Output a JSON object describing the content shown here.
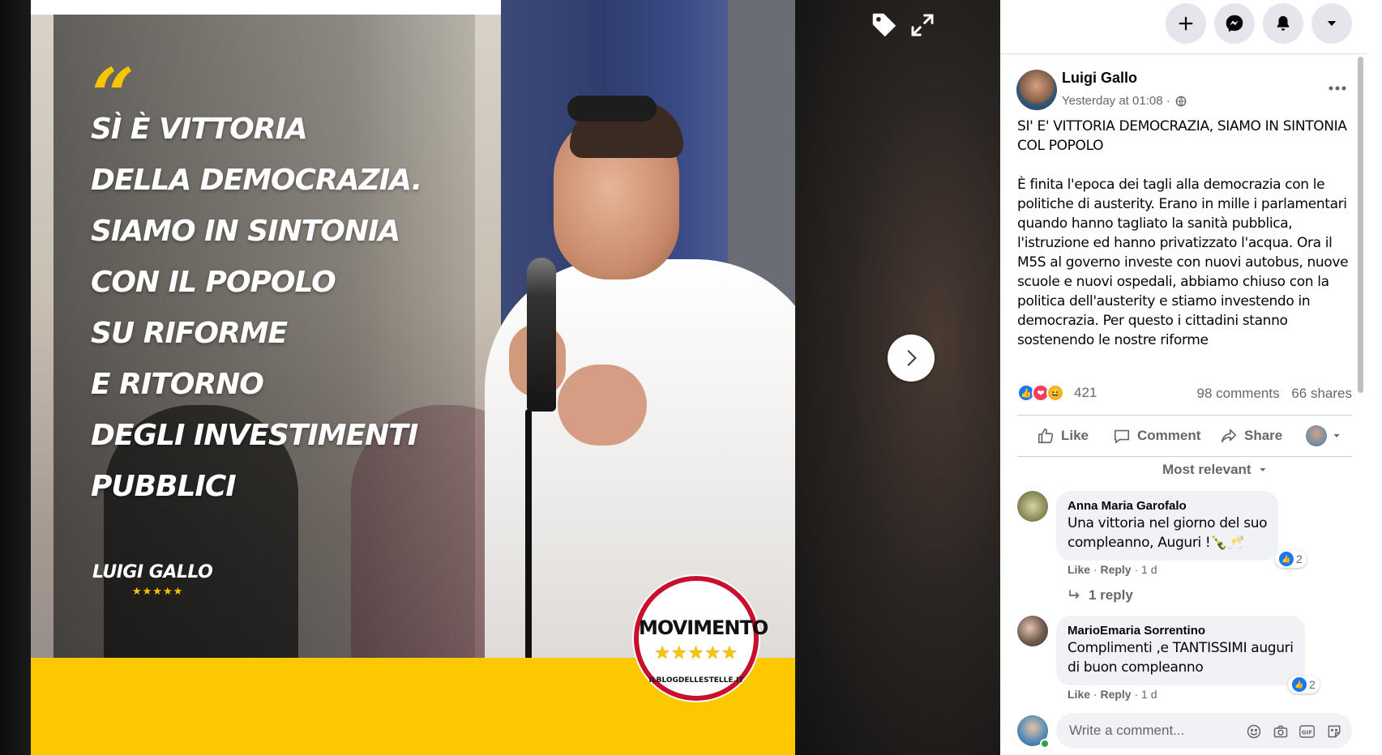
{
  "photo": {
    "quote_mark": "“",
    "quote_lines": [
      "SÌ È VITTORIA",
      "DELLA DEMOCRAZIA.",
      "SIAMO IN SINTONIA",
      "CON IL POPOLO",
      "SU RIFORME",
      "E RITORNO",
      "DEGLI INVESTIMENTI",
      "PUBBLICI"
    ],
    "signature": "LUIGI GALLO",
    "signature_stars": "★★★★★",
    "logo_word": "MOVIMENTO",
    "logo_stars": "★★★★★",
    "logo_url": "ILBLOGDELLESTELLE.IT"
  },
  "viewer": {
    "tag_icon": "tag-icon",
    "expand_icon": "expand-icon",
    "next_icon": "chevron-right-icon"
  },
  "topbar": {
    "buttons": [
      "plus-icon",
      "messenger-icon",
      "bell-icon",
      "caret-down-icon"
    ]
  },
  "post": {
    "author": "Luigi Gallo",
    "time": "Yesterday at 01:08 ·",
    "audience_icon": "globe-icon",
    "more_icon": "more-icon",
    "paragraphs": [
      "SI' E' VITTORIA DEMOCRAZIA, SIAMO IN SINTONIA COL POPOLO",
      "È finita l'epoca dei tagli alla democrazia con le politiche di austerity. Erano in mille i parlamentari quando hanno tagliato la sanità pubblica, l'istruzione ed hanno privatizzato l'acqua. Ora il M5S al governo investe con nuovi autobus, nuove scuole e nuovi ospedali, abbiamo chiuso con la politica dell'austerity e stiamo investendo in democrazia. Per questo i cittadini stanno sostenendo le nostre riforme"
    ],
    "reaction_count": "421",
    "comments_count": "98 comments",
    "shares_count": "66 shares"
  },
  "actions": {
    "like": "Like",
    "comment": "Comment",
    "share": "Share"
  },
  "comments_sort": "Most relevant",
  "comments": [
    {
      "name": "Anna Maria Garofalo",
      "text_lines": [
        "Una vittoria nel giorno del suo",
        "compleanno, Auguri !🍾🥂"
      ],
      "like": "Like",
      "reply": "Reply",
      "age": "· 1 d",
      "reaction_count": "2",
      "replies_label": "1 reply"
    },
    {
      "name": "MarioEmaria Sorrentino",
      "text_lines": [
        "Complimenti ,e TANTISSIMI auguri",
        "di buon compleanno"
      ],
      "like": "Like",
      "reply": "Reply",
      "age": "· 1 d",
      "reaction_count": "2"
    }
  ],
  "write_comment": {
    "placeholder": "Write a comment...",
    "tools": [
      "emoji-icon",
      "camera-icon",
      "gif-icon",
      "sticker-icon"
    ]
  },
  "colors": {
    "brand_blue": "#1877f2",
    "accent_yellow": "#fcc900",
    "logo_red": "#c8102e"
  }
}
